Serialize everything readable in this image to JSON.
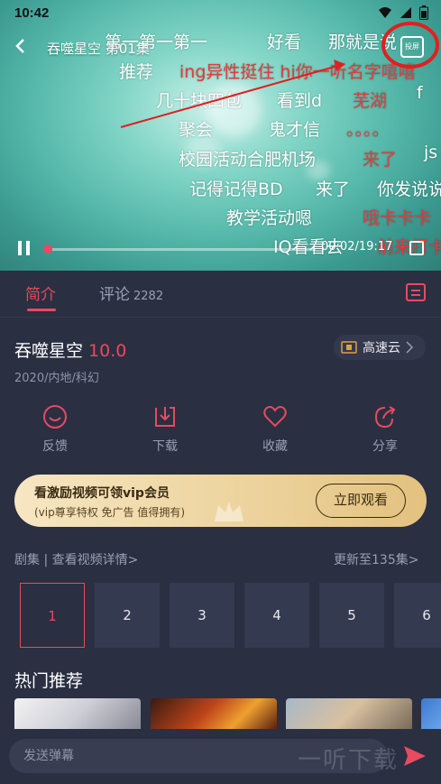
{
  "status_bar": {
    "time": "10:42"
  },
  "player": {
    "title": "吞噬星空 第01集",
    "cast_label": "投屏",
    "time_readout": "00:02/19:17",
    "progress": 0.01
  },
  "danmaku": [
    {
      "text": "第一第一第一",
      "color": "white"
    },
    {
      "text": "好看",
      "color": "white"
    },
    {
      "text": "那就是说",
      "color": "white"
    },
    {
      "text": "推荐",
      "color": "white"
    },
    {
      "text": "ing异性挺住 hi你一听名字嘻嘻",
      "color": "red"
    },
    {
      "text": "几十块四包",
      "color": "white"
    },
    {
      "text": "看到d",
      "color": "white"
    },
    {
      "text": "芜湖",
      "color": "red"
    },
    {
      "text": "f",
      "color": "white"
    },
    {
      "text": "聚会",
      "color": "white"
    },
    {
      "text": "鬼才信",
      "color": "white"
    },
    {
      "text": "。。。。",
      "color": "red"
    },
    {
      "text": "校园活动合肥机场",
      "color": "white"
    },
    {
      "text": "来了",
      "color": "red"
    },
    {
      "text": "js",
      "color": "white"
    },
    {
      "text": "记得记得BD",
      "color": "white"
    },
    {
      "text": "来了",
      "color": "white"
    },
    {
      "text": "你发说说",
      "color": "white"
    },
    {
      "text": "教学活动嗯",
      "color": "white"
    },
    {
      "text": "哦卡卡卡",
      "color": "red"
    },
    {
      "text": "IQ看看去",
      "color": "white"
    },
    {
      "text": "前来打卡",
      "color": "red"
    }
  ],
  "tabs": {
    "intro": "简介",
    "comments": "评论",
    "comments_count": "2282"
  },
  "show": {
    "title": "吞噬星空",
    "score": "10.0",
    "meta": "2020/内地/科幻",
    "source": "高速云"
  },
  "actions": {
    "feedback": "反馈",
    "download": "下载",
    "favorite": "收藏",
    "share": "分享"
  },
  "vip_banner": {
    "line1": "看激励视频可领vip会员",
    "line2": "(vip尊享特权 免广告 值得拥有)",
    "button": "立即观看"
  },
  "episodes": {
    "header_left": "剧集 | 查看视频详情>",
    "header_right": "更新至135集>",
    "items": [
      "1",
      "2",
      "3",
      "4",
      "5",
      "6"
    ]
  },
  "recommend": {
    "title": "热门推荐"
  },
  "bottom": {
    "placeholder": "发送弹幕",
    "watermark": "一听下载"
  },
  "colors": {
    "accent": "#e84a5f",
    "background": "#2a2f42",
    "vip_gold": "#ecd29b"
  }
}
